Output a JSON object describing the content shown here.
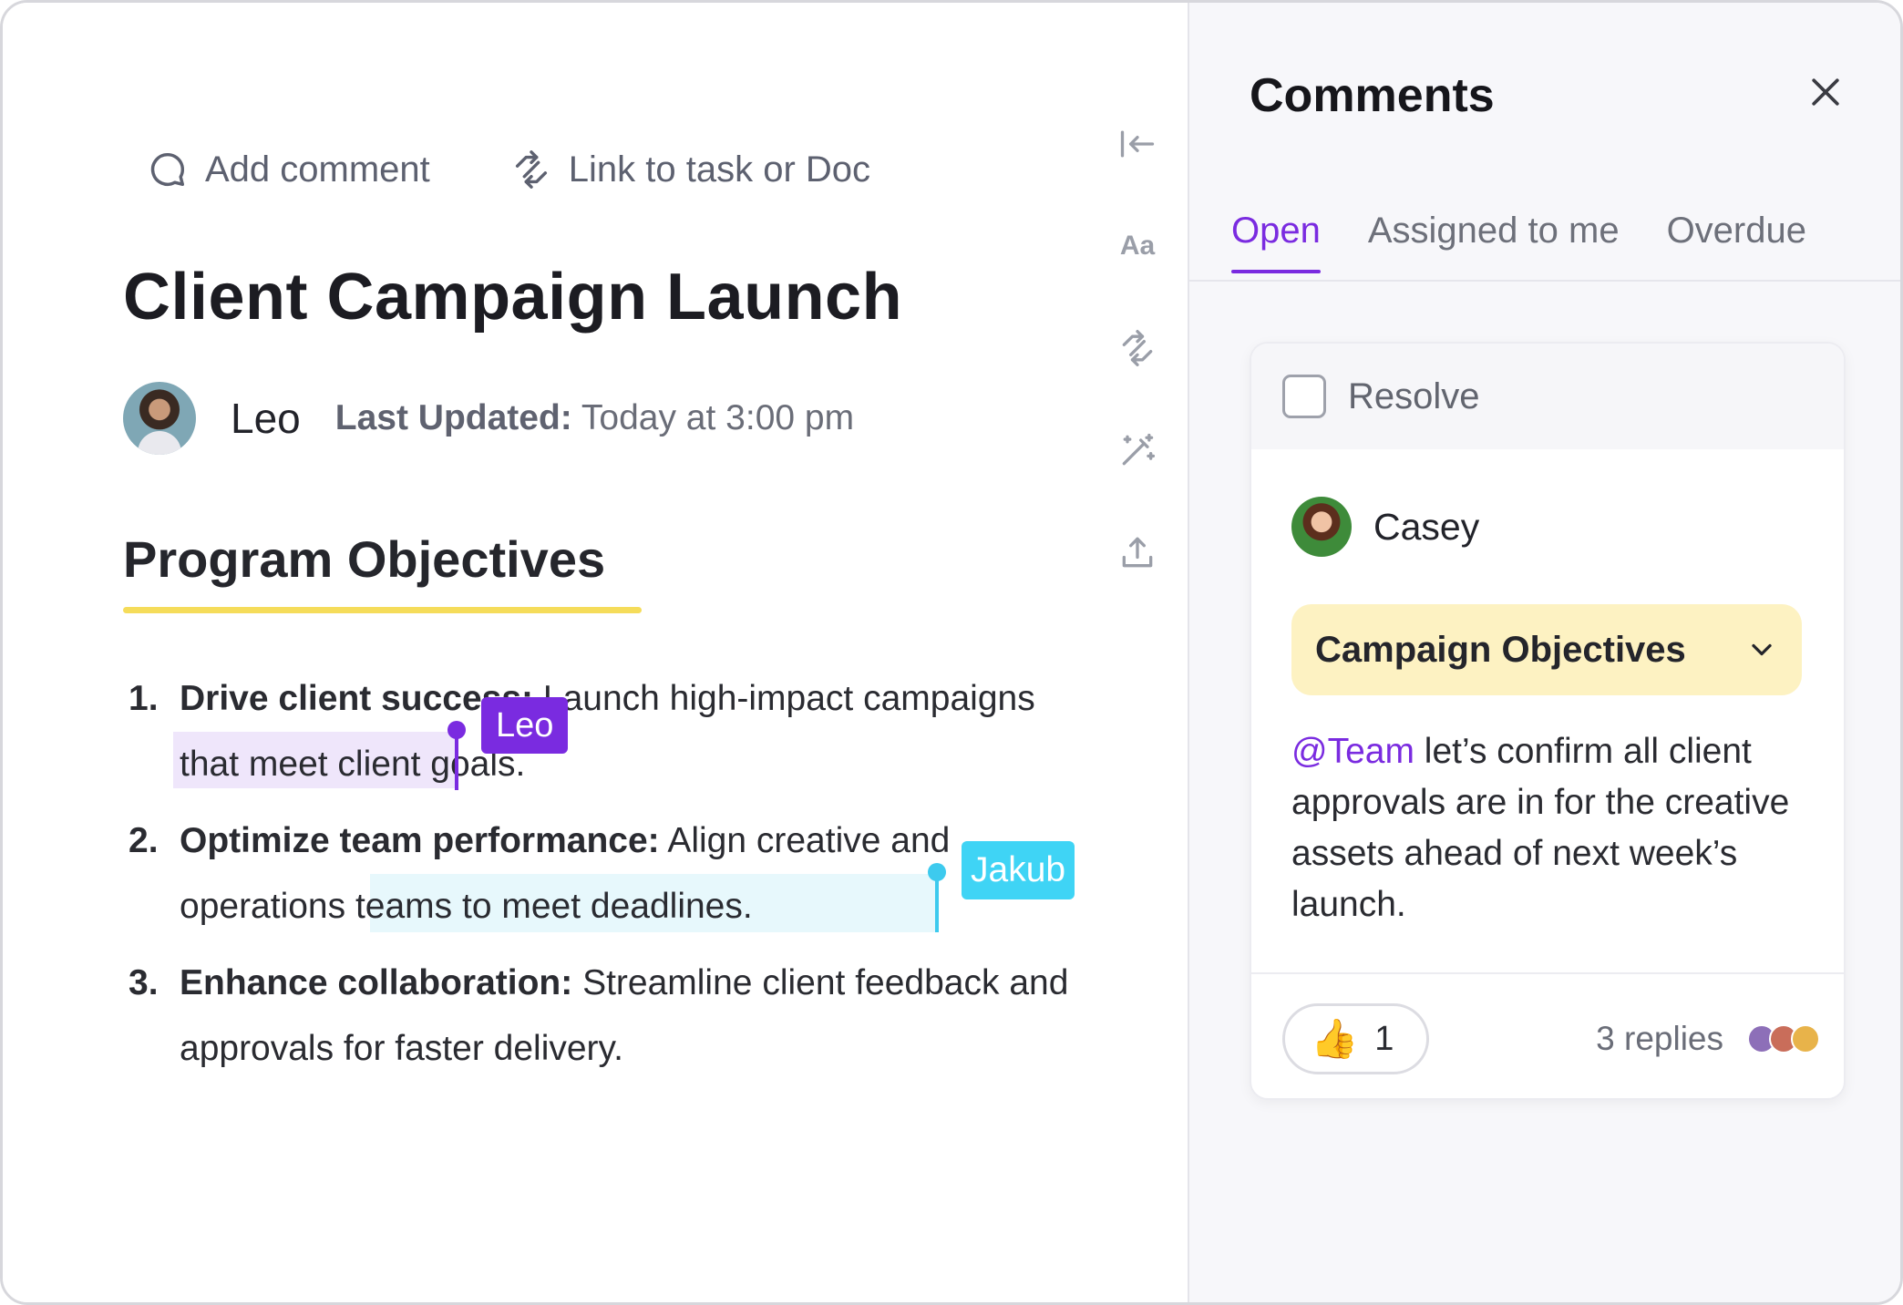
{
  "toolbar": {
    "add_comment": "Add comment",
    "link_task": "Link to task or Doc"
  },
  "doc": {
    "title": "Client Campaign Launch",
    "author": "Leo",
    "updated_label": "Last Updated:",
    "updated_value": "Today at 3:00 pm",
    "section_title": "Program Objectives",
    "objectives": [
      {
        "num": "1.",
        "bold": "Drive client success:",
        "text": " Launch high-impact campaigns that meet client goals."
      },
      {
        "num": "2.",
        "bold": "Optimize team performance:",
        "text": " Align creative and operations teams to meet deadlines."
      },
      {
        "num": "3.",
        "bold": "Enhance collaboration:",
        "text": " Streamline client feedback and approvals for faster delivery."
      }
    ],
    "cursors": {
      "leo": "Leo",
      "jakub": "Jakub"
    },
    "rail_aa": "Aa"
  },
  "panel": {
    "title": "Comments",
    "tabs": [
      "Open",
      "Assigned to me",
      "Overdue"
    ],
    "active_tab": "Open",
    "comment": {
      "resolve_label": "Resolve",
      "author": "Casey",
      "topic": "Campaign Objectives",
      "mention": "@Team",
      "body": " let’s confirm all client approvals are in for the creative assets ahead of next week’s launch.",
      "reaction_emoji": "👍",
      "reaction_count": "1",
      "replies": "3 replies"
    }
  },
  "colors": {
    "accent": "#7a2be0",
    "cursor_jakub": "#3fd4f5",
    "section_underline": "#f5dc5a",
    "topic_bg": "#fdf2c2"
  },
  "icons": [
    "comment-icon",
    "link-icon",
    "collapse-icon",
    "font-icon",
    "relation-icon",
    "magic-wand-icon",
    "upload-icon",
    "close-icon",
    "chevron-down-icon",
    "thumbs-up-icon"
  ]
}
